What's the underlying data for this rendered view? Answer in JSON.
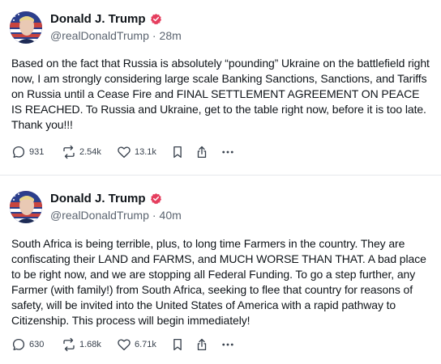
{
  "posts": [
    {
      "author": {
        "name": "Donald J. Trump",
        "handle": "@realDonaldTrump",
        "verified": true
      },
      "time": "28m",
      "text": "Based on the fact that Russia is absolutely “pounding” Ukraine on the battlefield right now, I am strongly considering large scale Banking Sanctions, Sanctions, and Tariffs on Russia until a Cease Fire and FINAL SETTLEMENT AGREEMENT ON PEACE IS REACHED. To Russia and Ukraine, get to the table right now, before it is too late. Thank you!!!",
      "actions": {
        "replies": "931",
        "retruths": "2.54k",
        "likes": "13.1k"
      }
    },
    {
      "author": {
        "name": "Donald J. Trump",
        "handle": "@realDonaldTrump",
        "verified": true
      },
      "time": "40m",
      "text": "South Africa is being terrible, plus, to long time Farmers in the country. They are confiscating their LAND and FARMS, and MUCH WORSE THAN THAT. A bad place to be right now, and we are stopping all Federal Funding. To go a step further, any Farmer (with family!) from South Africa, seeking to flee that country for reasons of safety, will be invited into the United States of America with a rapid pathway to Citizenship. This process will begin immediately!",
      "actions": {
        "replies": "630",
        "retruths": "1.68k",
        "likes": "6.71k"
      }
    }
  ],
  "icons": {
    "reply": "reply-icon",
    "retruth": "retruth-icon",
    "like": "heart-icon",
    "bookmark": "bookmark-icon",
    "share": "share-icon",
    "more": "more-icon",
    "verified": "verified-badge-icon"
  },
  "colors": {
    "verified_badge": "#e53e5e",
    "text": "#0f1419",
    "muted": "#5b6470",
    "divider": "#e6e8eb"
  }
}
